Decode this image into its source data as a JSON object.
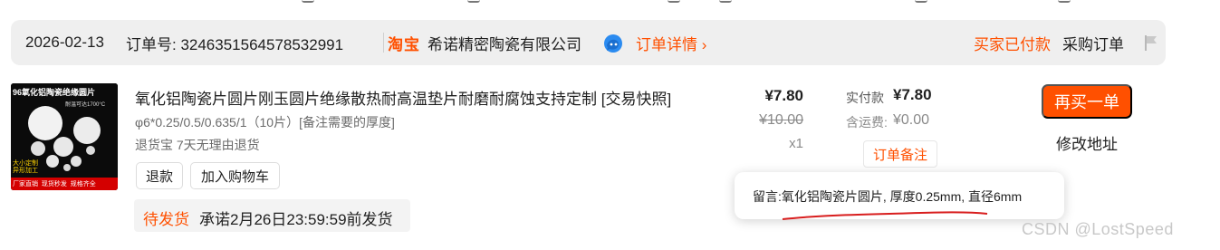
{
  "header": {
    "date": "2026-02-13",
    "order_no": "订单号: 3246351564578532991",
    "platform_logo": "淘宝",
    "shop_name": "希诺精密陶瓷有限公司",
    "order_detail_link": "订单详情 ›",
    "status": "买家已付款",
    "order_type": "采购订单",
    "icons": [
      "chat-icon",
      "flag-icon"
    ]
  },
  "item": {
    "thumbnail": {
      "banner": "96氧化铝陶瓷绝缘圆片",
      "temp_text": "耐温可达1700°C",
      "custom_text": "大小定制\n异形加工",
      "footer": "厂家直销  现货秒发  规格齐全"
    },
    "title": "氧化铝陶瓷片圆片刚玉圆片绝缘散热耐高温垫片耐磨耐腐蚀支持定制 [交易快照]",
    "spec": "φ6*0.25/0.5/0.635/1（10片）[备注需要的厚度]",
    "refund_policy": "退货宝 7天无理由退货",
    "buttons": {
      "refund": "退款",
      "add_to_cart": "加入购物车"
    },
    "pending": {
      "label": "待发货",
      "promise": "承诺2月26日23:59:59前发货"
    },
    "price": "¥7.80",
    "original_price": "¥10.00",
    "quantity": "x1"
  },
  "payment": {
    "paid_label": "实付款",
    "paid_value": "¥7.80",
    "shipping_label": "含运费:",
    "shipping_value": "¥0.00",
    "note_button": "订单备注"
  },
  "actions": {
    "rebuy": "再买一单",
    "modify_address": "修改地址"
  },
  "tooltip": {
    "text": "留言:氧化铝陶瓷片圆片, 厚度0.25mm, 直径6mm"
  },
  "watermark": "CSDN @LostSpeed",
  "colors": {
    "accent": "#ff5000",
    "header_bg": "#efefef",
    "underline": "#d81e1e"
  }
}
